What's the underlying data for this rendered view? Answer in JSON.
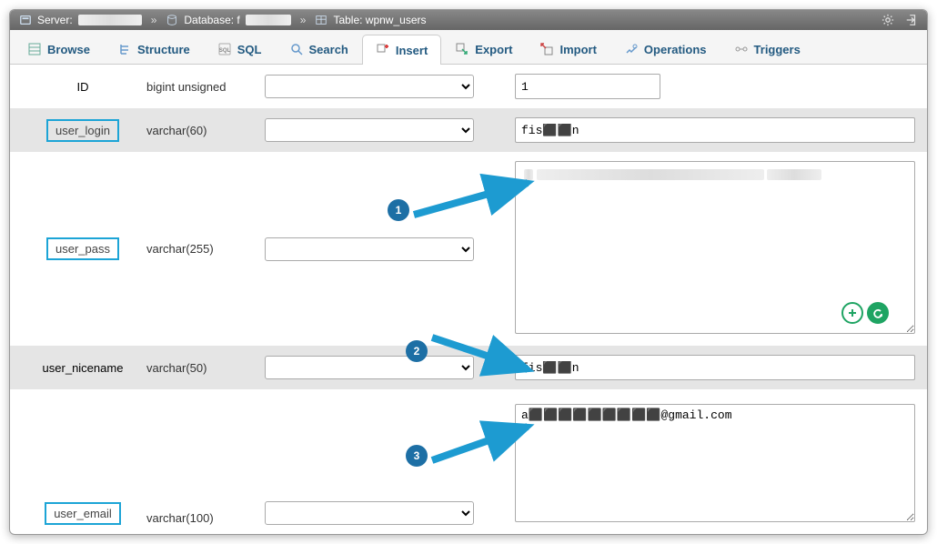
{
  "breadcrumb": {
    "server_label": "Server:",
    "server_value": "",
    "db_label": "Database: f",
    "db_value": "",
    "table_label": "Table: wpnw_users"
  },
  "tabs": [
    {
      "id": "browse",
      "label": "Browse"
    },
    {
      "id": "structure",
      "label": "Structure"
    },
    {
      "id": "sql",
      "label": "SQL"
    },
    {
      "id": "search",
      "label": "Search"
    },
    {
      "id": "insert",
      "label": "Insert",
      "active": true
    },
    {
      "id": "export",
      "label": "Export"
    },
    {
      "id": "import",
      "label": "Import"
    },
    {
      "id": "operations",
      "label": "Operations"
    },
    {
      "id": "triggers",
      "label": "Triggers"
    }
  ],
  "rows": {
    "id": {
      "name": "ID",
      "type": "bigint unsigned",
      "value": "1"
    },
    "user_login": {
      "name": "user_login",
      "type": "varchar(60)",
      "value": "fis⬛⬛n"
    },
    "user_pass": {
      "name": "user_pass",
      "type": "varchar(255)",
      "value": ""
    },
    "user_nicename": {
      "name": "user_nicename",
      "type": "varchar(50)",
      "value": "fis⬛⬛n"
    },
    "user_email": {
      "name": "user_email",
      "type": "varchar(100)",
      "value": "a⬛⬛⬛⬛⬛⬛⬛⬛⬛@gmail.com"
    }
  },
  "annotations": [
    "1",
    "2",
    "3"
  ]
}
